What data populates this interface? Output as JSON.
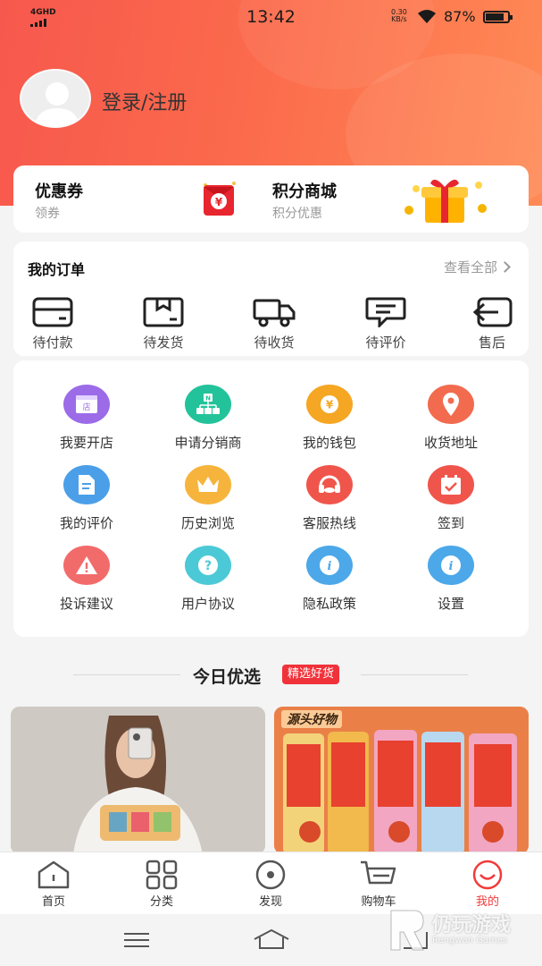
{
  "status_bar": {
    "network": "4GHD",
    "time": "13:42",
    "speed_value": "0.30",
    "speed_unit": "KB/s",
    "battery": "87%"
  },
  "profile": {
    "login_label": "登录/注册"
  },
  "promo": {
    "coupon_title": "优惠券",
    "coupon_sub": "领券",
    "points_title": "积分商城",
    "points_sub": "积分优惠"
  },
  "orders": {
    "title": "我的订单",
    "view_all": "查看全部",
    "items": [
      {
        "label": "待付款",
        "icon": "wallet-icon"
      },
      {
        "label": "待发货",
        "icon": "box-icon"
      },
      {
        "label": "待收货",
        "icon": "truck-icon"
      },
      {
        "label": "待评价",
        "icon": "comment-icon"
      },
      {
        "label": "售后",
        "icon": "return-icon"
      }
    ]
  },
  "services": {
    "items": [
      {
        "label": "我要开店",
        "icon": "shop-icon",
        "color": "#9b6be8"
      },
      {
        "label": "申请分销商",
        "icon": "network-icon",
        "color": "#22c39a"
      },
      {
        "label": "我的钱包",
        "icon": "coin-icon",
        "color": "#f5a623"
      },
      {
        "label": "收货地址",
        "icon": "location-icon",
        "color": "#f26b4e"
      },
      {
        "label": "我的评价",
        "icon": "document-icon",
        "color": "#4a9fe8"
      },
      {
        "label": "历史浏览",
        "icon": "crown-icon",
        "color": "#f6b43c"
      },
      {
        "label": "客服热线",
        "icon": "headset-icon",
        "color": "#f0554b"
      },
      {
        "label": "签到",
        "icon": "calendar-icon",
        "color": "#f0554b"
      },
      {
        "label": "投诉建议",
        "icon": "warning-icon",
        "color": "#f26b6b"
      },
      {
        "label": "用户协议",
        "icon": "question-icon",
        "color": "#4cc9d6"
      },
      {
        "label": "隐私政策",
        "icon": "info-icon",
        "color": "#4ca8e8"
      },
      {
        "label": "设置",
        "icon": "info-icon",
        "color": "#4ca8e8"
      }
    ]
  },
  "featured": {
    "title": "今日优选",
    "badge": "精选好货",
    "product2_tag": "源头好物"
  },
  "tabbar": {
    "items": [
      {
        "label": "首页",
        "icon": "home-icon",
        "active": false
      },
      {
        "label": "分类",
        "icon": "grid-icon",
        "active": false
      },
      {
        "label": "发现",
        "icon": "discover-icon",
        "active": false
      },
      {
        "label": "购物车",
        "icon": "cart-icon",
        "active": false
      },
      {
        "label": "我的",
        "icon": "profile-icon",
        "active": true
      }
    ]
  },
  "watermark": {
    "text": "仍玩游戏",
    "sub": "Rengwan Games"
  },
  "colors": {
    "accent": "#f23a3a",
    "hero_start": "#f7584d",
    "hero_end": "#ff8a55"
  }
}
